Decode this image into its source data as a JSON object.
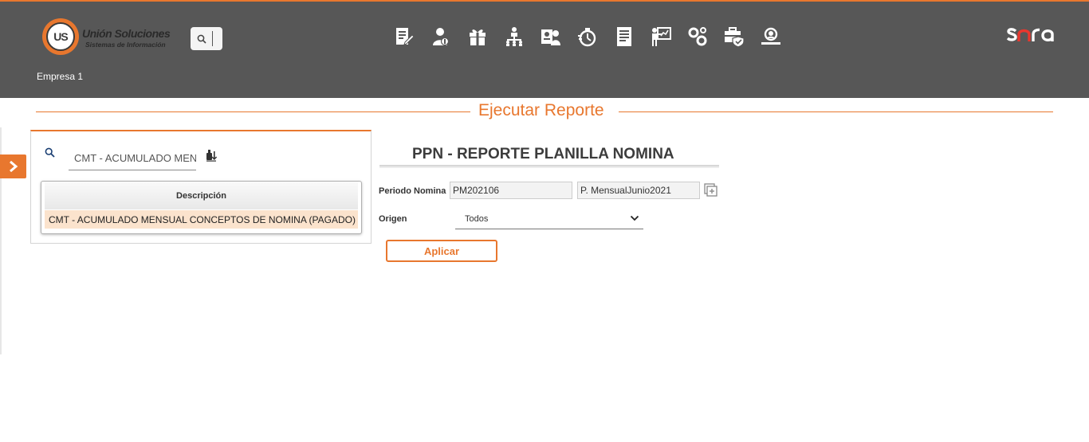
{
  "header": {
    "logo": {
      "mark": "US",
      "name": "Unión Soluciones",
      "tagline": "Sistemas de Información"
    },
    "company": "Empresa 1",
    "nav_icons": [
      "document-edit-icon",
      "user-money-icon",
      "gift-icon",
      "org-chart-icon",
      "id-card-icon",
      "stopwatch-icon",
      "report-list-icon",
      "presentation-icon",
      "gears-icon",
      "briefcase-shield-icon",
      "user-search-icon"
    ],
    "brand": "sara"
  },
  "page": {
    "title": "Ejecutar Reporte"
  },
  "search_panel": {
    "query": "CMT - ACUMULADO MENS",
    "table": {
      "header": "Descripción",
      "rows": [
        "CMT - ACUMULADO MENSUAL CONCEPTOS DE NOMINA (PAGADO)"
      ]
    }
  },
  "report": {
    "title": "PPN - REPORTE PLANILLA NOMINA",
    "periodo_label": "Periodo Nomina",
    "periodo_code": "PM202106",
    "periodo_name": "P. MensualJunio2021",
    "origen_label": "Origen",
    "origen_value": "Todos",
    "apply_label": "Aplicar"
  },
  "colors": {
    "accent": "#e8772e",
    "header_bg": "#575757",
    "selected_row": "#fbe3cd"
  }
}
